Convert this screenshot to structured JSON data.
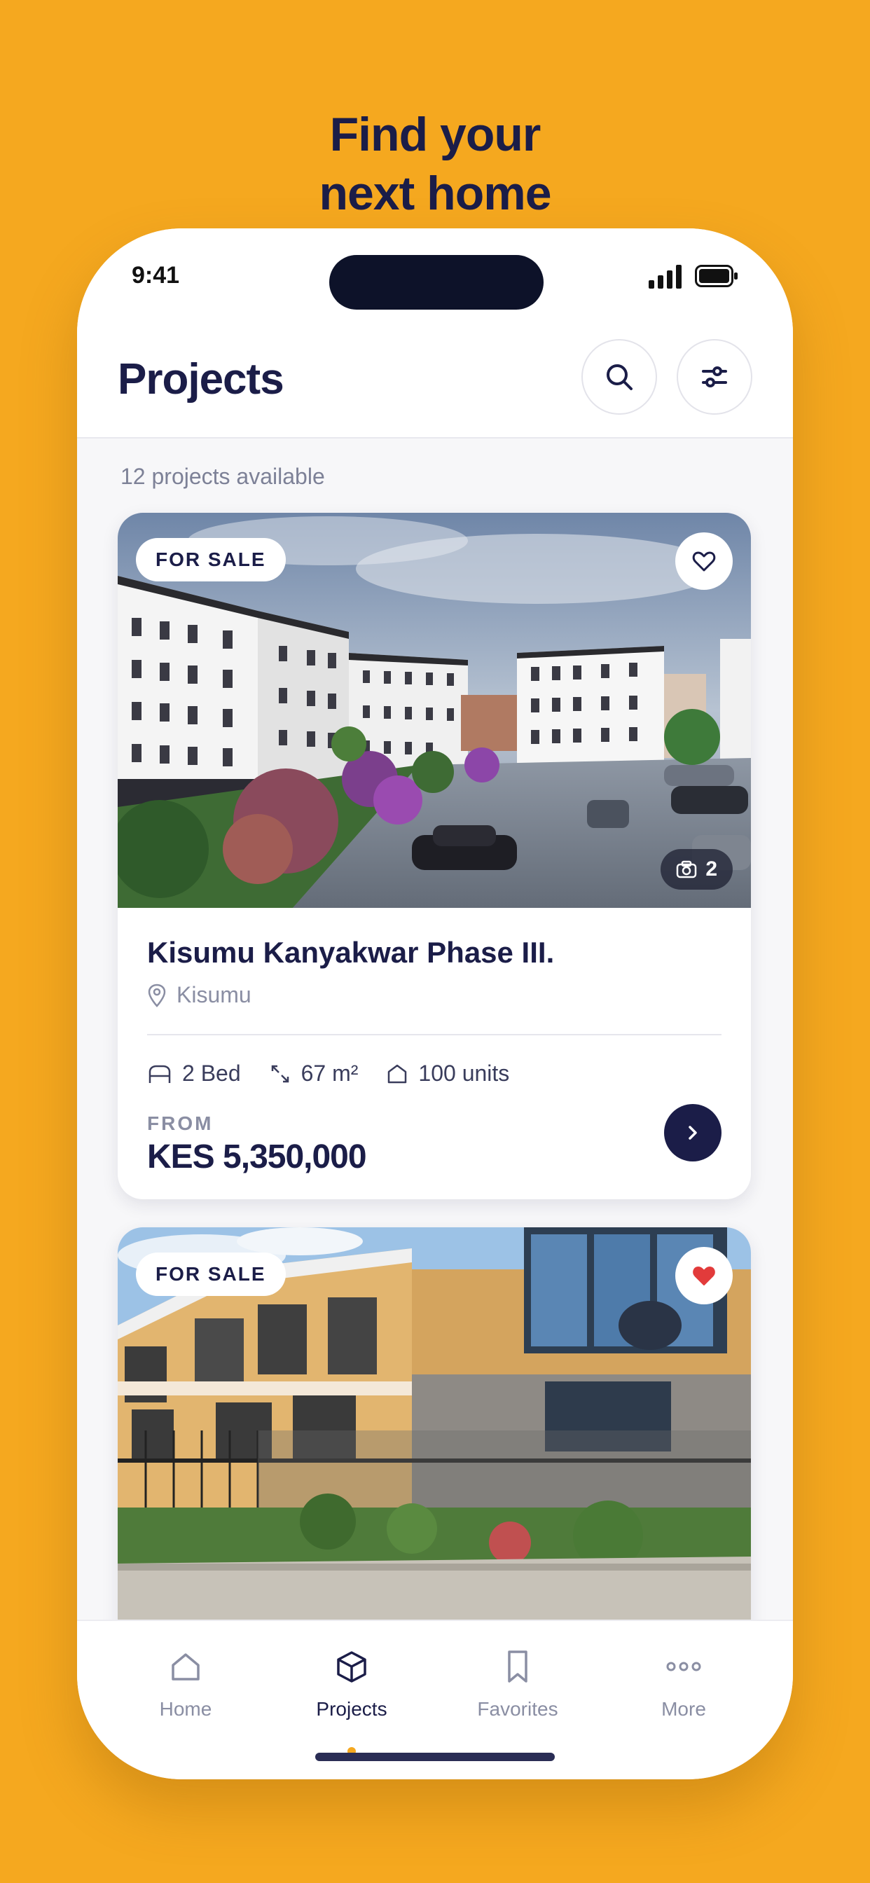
{
  "promo": {
    "headline_line1": "Find your",
    "headline_line2": "next home"
  },
  "status_bar": {
    "time": "9:41"
  },
  "header": {
    "title": "Projects",
    "search_icon": "search-icon",
    "filter_icon": "sliders-icon"
  },
  "listing": {
    "count_text": "12 projects available"
  },
  "cards": [
    {
      "badge": "FOR SALE",
      "favorited": false,
      "photo_count": "2",
      "title": "Kisumu Kanyakwar Phase III.",
      "location": "Kisumu",
      "beds": "2 Bed",
      "area": "67 m²",
      "units": "100 units",
      "price_label": "FROM",
      "price": "KES 5,350,000"
    },
    {
      "badge": "FOR SALE",
      "favorited": true
    }
  ],
  "tab_bar": {
    "active": "Projects",
    "items": [
      {
        "label": "Home",
        "icon": "home-icon"
      },
      {
        "label": "Projects",
        "icon": "cube-icon"
      },
      {
        "label": "Favorites",
        "icon": "bookmark-icon"
      },
      {
        "label": "More",
        "icon": "more-dots-icon"
      }
    ]
  },
  "colors": {
    "background": "#F5A81F",
    "primary": "#1B1D48",
    "favorite": "#E23B3B",
    "muted": "#8A8EA3"
  }
}
